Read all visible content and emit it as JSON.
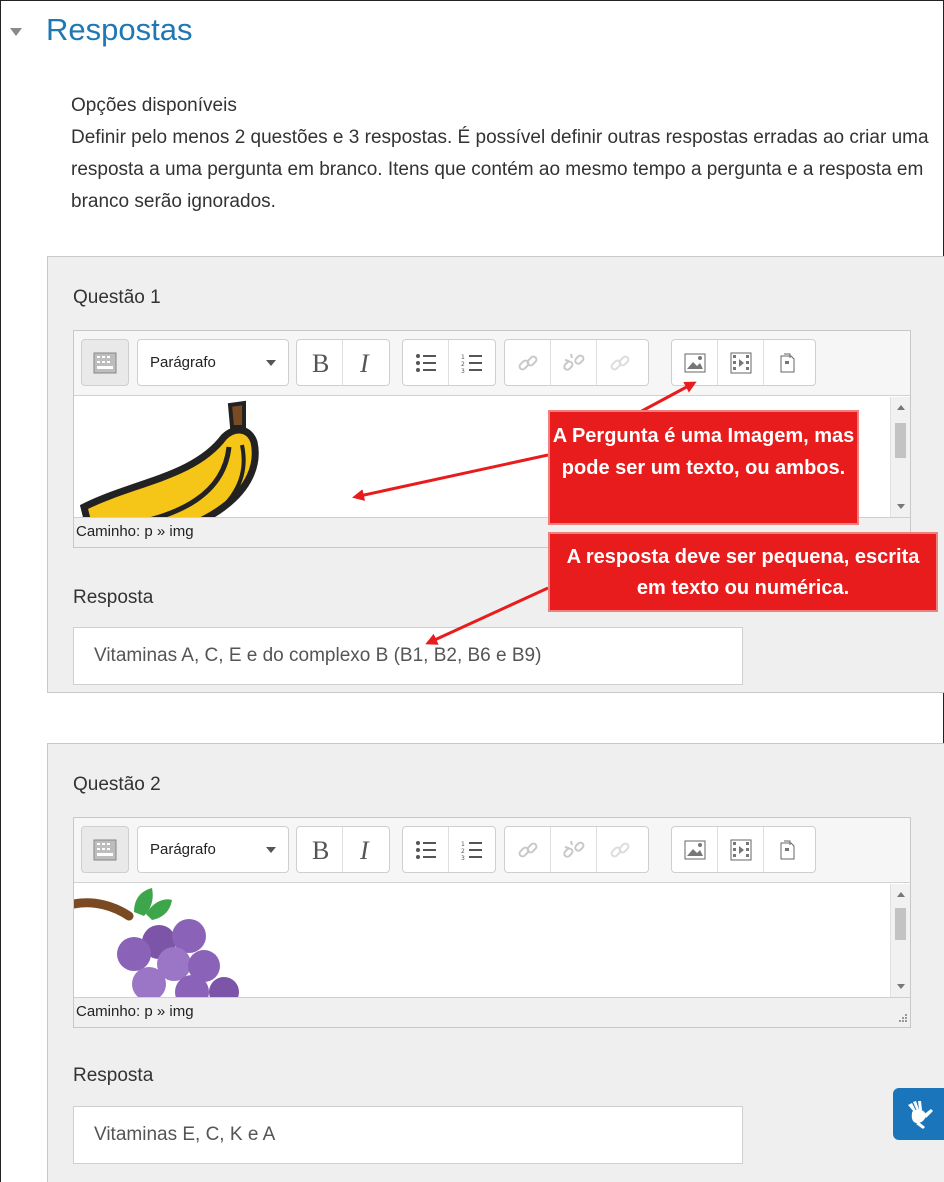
{
  "section": {
    "title": "Respostas"
  },
  "intro": {
    "heading": "Opções disponíveis",
    "text": "Definir pelo menos 2 questões e 3 respostas. É possível definir outras respostas erradas ao criar uma resposta a uma pergunta em branco. Itens que contém ao mesmo tempo a pergunta e a resposta em branco serão ignorados."
  },
  "questions": [
    {
      "label": "Questão 1",
      "editor": {
        "format_select": "Parágrafo",
        "path": "Caminho: p » img",
        "image_icon": "banana-image"
      },
      "answer_label": "Resposta",
      "answer_value": "Vitaminas A, C, E e do complexo B (B1, B2, B6 e B9)"
    },
    {
      "label": "Questão 2",
      "editor": {
        "format_select": "Parágrafo",
        "path": "Caminho: p » img",
        "image_icon": "grapes-image"
      },
      "answer_label": "Resposta",
      "answer_value": "Vitaminas E, C, K e A"
    }
  ],
  "toolbar_icons": [
    "toolbar-toggle-icon",
    "bold-icon",
    "italic-icon",
    "unordered-list-icon",
    "ordered-list-icon",
    "link-icon",
    "unlink-icon",
    "autolink-icon",
    "image-icon",
    "media-icon",
    "manage-files-icon"
  ],
  "callouts": {
    "question": "A Pergunta  é uma Imagem, mas pode ser um texto, ou ambos.",
    "answer": "A resposta deve ser pequena, escrita em texto ou numérica."
  },
  "accessibility": {
    "icon": "sign-language-icon"
  },
  "colors": {
    "title": "#1f78b4",
    "callout": "#e81c1c",
    "panel": "#efefef",
    "accessibility": "#1b75bb"
  }
}
